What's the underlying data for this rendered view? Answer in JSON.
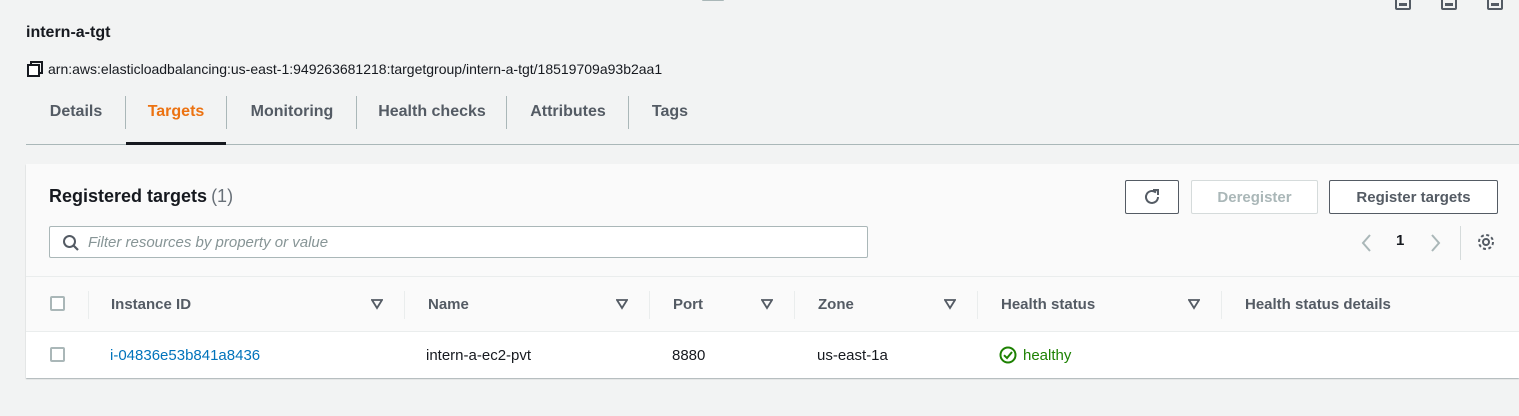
{
  "header": {
    "title": "intern-a-tgt",
    "arn": "arn:aws:elasticloadbalancing:us-east-1:949263681218:targetgroup/intern-a-tgt/18519709a93b2aa1"
  },
  "tabs": [
    {
      "label": "Details"
    },
    {
      "label": "Targets"
    },
    {
      "label": "Monitoring"
    },
    {
      "label": "Health checks"
    },
    {
      "label": "Attributes"
    },
    {
      "label": "Tags"
    }
  ],
  "active_tab": "Targets",
  "panel": {
    "title": "Registered targets",
    "count": "(1)",
    "deregister_label": "Deregister",
    "register_label": "Register targets",
    "search_placeholder": "Filter resources by property or value",
    "page": "1"
  },
  "table": {
    "columns": [
      "Instance ID",
      "Name",
      "Port",
      "Zone",
      "Health status",
      "Health status details"
    ],
    "rows": [
      {
        "instance_id": "i-04836e53b841a8436",
        "name": "intern-a-ec2-pvt",
        "port": "8880",
        "zone": "us-east-1a",
        "health_status": "healthy",
        "health_status_details": ""
      }
    ]
  },
  "colors": {
    "accent": "#ec7211",
    "link": "#0073bb",
    "healthy": "#1d8102"
  },
  "icons": [
    "copy-icon",
    "refresh-icon",
    "search-icon",
    "chevron-left-icon",
    "chevron-right-icon",
    "gear-icon",
    "sort-icon",
    "status-ok-icon"
  ]
}
